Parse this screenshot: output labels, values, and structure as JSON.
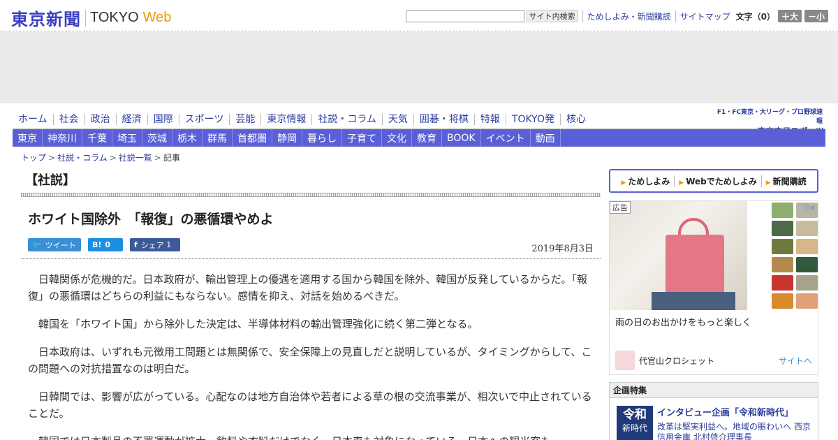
{
  "header": {
    "logo_main": "東京新聞",
    "logo_sub": "TOKYO",
    "logo_web": "Web",
    "search_button": "サイト内検索",
    "links": [
      "ためしよみ・新聞購読",
      "サイトマップ"
    ],
    "fontsize_label": "文字（0）",
    "font_bigger": "＋大",
    "font_smaller": "－小"
  },
  "nav_primary": [
    "ホーム",
    "社会",
    "政治",
    "経済",
    "国際",
    "スポーツ",
    "芸能",
    "東京情報",
    "社説・コラム",
    "天気",
    "囲碁・将棋",
    "特報",
    "TOKYO発",
    "核心"
  ],
  "brand_link": {
    "top": "F1・FC東京・大リーグ・プロ野球速報",
    "main": "東京中日スポーツ"
  },
  "nav_secondary": [
    "東京",
    "神奈川",
    "千葉",
    "埼玉",
    "茨城",
    "栃木",
    "群馬",
    "首都圏",
    "静岡",
    "暮らし",
    "子育て",
    "文化",
    "教育",
    "BOOK",
    "イベント",
    "動画"
  ],
  "breadcrumb": [
    "トップ",
    "社説・コラム",
    "社説一覧",
    "記事"
  ],
  "article": {
    "section": "【社説】",
    "headline": "ホワイト国除外　「報復」の悪循環やめよ",
    "date": "2019年8月3日",
    "share": {
      "tweet": "ツイート",
      "hatena": "0",
      "fb_label": "シェア",
      "fb_count": "1"
    },
    "paragraphs": [
      "日韓関係が危機的だ。日本政府が、輸出管理上の優遇を適用する国から韓国を除外、韓国が反発しているからだ。「報復」の悪循環はどちらの利益にもならない。感情を抑え、対話を始めるべきだ。",
      "韓国を「ホワイト国」から除外した決定は、半導体材料の輸出管理強化に続く第二弾となる。",
      "日本政府は、いずれも元徴用工問題とは無関係で、安全保障上の見直しだと説明しているが、タイミングからして、この問題への対抗措置なのは明白だ。",
      "日韓間では、影響が広がっている。心配なのは地方自治体や若者による草の根の交流事業が、相次いで中止されていることだ。",
      "韓国では日本製品の不買運動が拡大、飲料や衣料だけでなく、日本車も対象になっている。日本への観光客も"
    ]
  },
  "sidebar": {
    "links": [
      "ためしよみ",
      "Webでためしよみ",
      "新聞購読"
    ],
    "ad": {
      "tag": "広告",
      "caption": "雨の日のお出かけをもっと楽しく",
      "brand": "代官山クロシェット",
      "cta": "サイトへ",
      "swatch_colors": [
        "#8fae6c",
        "#b8b4a8",
        "#4d6b48",
        "#c9bc9d",
        "#6f7a3f",
        "#d9b58a",
        "#b48a4c",
        "#2f5a3c",
        "#c8352e",
        "#a9a28a",
        "#d98a2c",
        "#e0a07a"
      ]
    },
    "feature": {
      "heading": "企画特集",
      "thumb_line1": "令和",
      "thumb_line2": "新時代",
      "title": "インタビュー企画「令和新時代」",
      "desc": "改革は堅実利益へ。地域の賑わいへ 西京信用金庫 北村啓介理事長"
    }
  }
}
